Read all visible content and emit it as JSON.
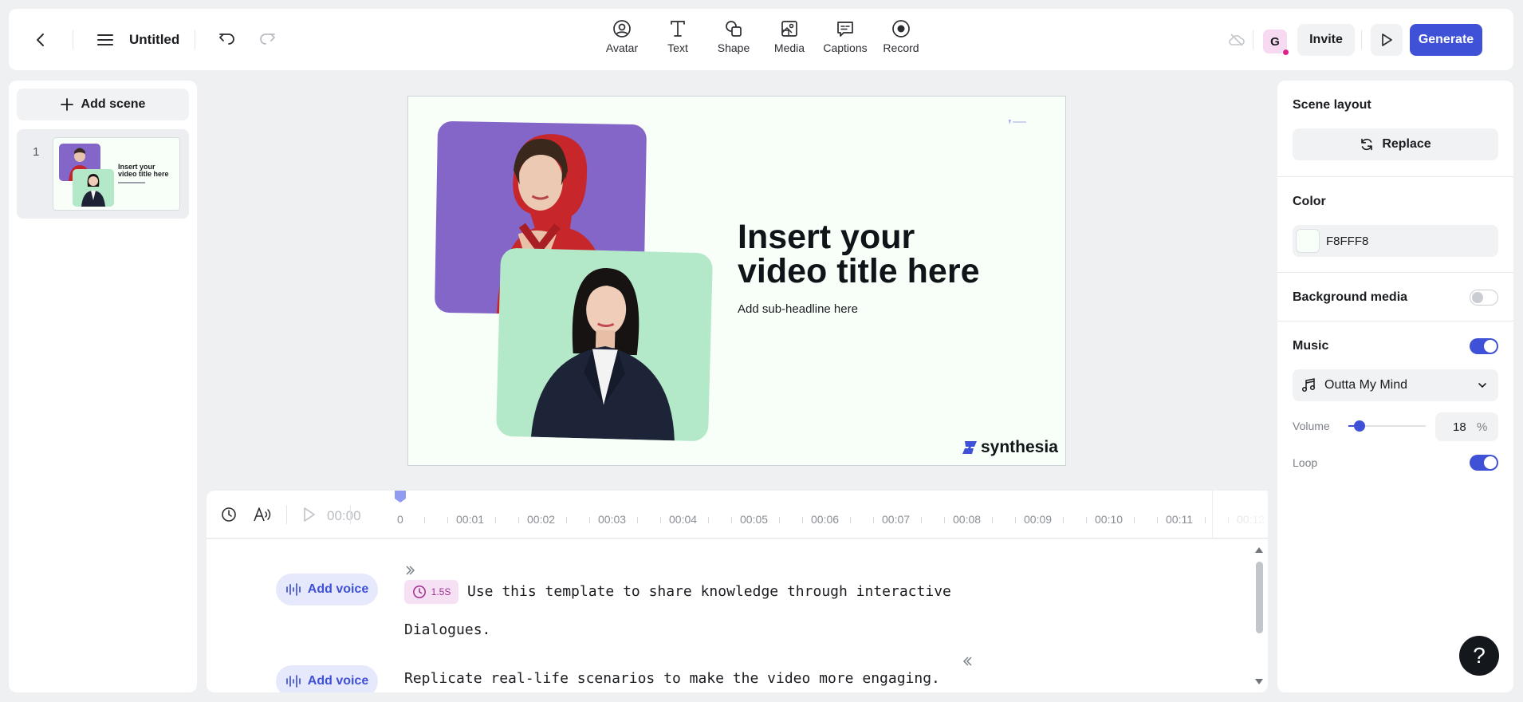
{
  "header": {
    "title": "Untitled",
    "tools": [
      {
        "label": "Avatar",
        "icon": "avatar-icon"
      },
      {
        "label": "Text",
        "icon": "text-icon"
      },
      {
        "label": "Shape",
        "icon": "shape-icon"
      },
      {
        "label": "Media",
        "icon": "media-icon"
      },
      {
        "label": "Captions",
        "icon": "captions-icon"
      },
      {
        "label": "Record",
        "icon": "record-icon"
      }
    ],
    "user_initial": "G",
    "invite_label": "Invite",
    "generate_label": "Generate"
  },
  "scenes": {
    "add_label": "Add scene",
    "items": [
      {
        "number": "1",
        "title": "Insert your video title here"
      }
    ]
  },
  "canvas": {
    "title_line1": "Insert your",
    "title_line2": "video title here",
    "subtitle": "Add sub-headline here",
    "brand": "synthesia",
    "background": "#F8FFF8"
  },
  "timeline": {
    "current_time": "00:00",
    "ticks": [
      "0",
      "00:01",
      "00:02",
      "00:03",
      "00:04",
      "00:05",
      "00:06",
      "00:07",
      "00:08",
      "00:09",
      "00:10",
      "00:11",
      "00:12"
    ]
  },
  "script": {
    "add_voice_label": "Add voice",
    "pause_label": "1.5S",
    "line1": "Use this template to share knowledge through interactive",
    "line2": "Dialogues.",
    "line3": "Replicate real-life scenarios to make the video more engaging."
  },
  "panel": {
    "scene_layout_label": "Scene layout",
    "replace_label": "Replace",
    "color_label": "Color",
    "color_value": "F8FFF8",
    "background_media_label": "Background media",
    "background_media_on": false,
    "music_label": "Music",
    "music_on": true,
    "music_track": "Outta My Mind",
    "volume_label": "Volume",
    "volume_value": "18",
    "volume_unit": "%",
    "loop_label": "Loop",
    "loop_on": true
  },
  "colors": {
    "accent": "#3F51D6",
    "avatar1_bg": "#8466C8",
    "avatar2_bg": "#B3E8C8"
  },
  "help_label": "?"
}
